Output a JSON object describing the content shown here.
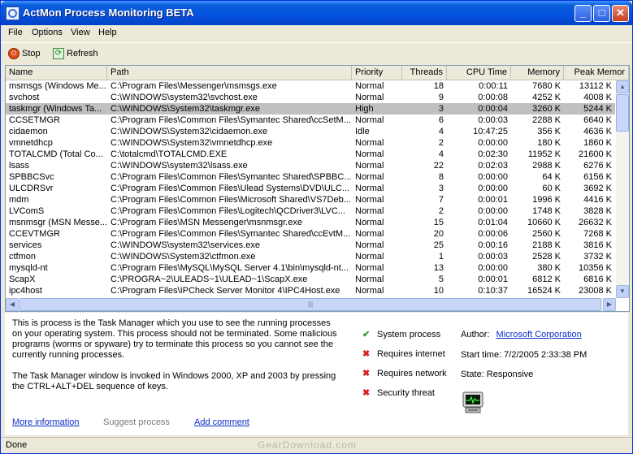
{
  "window": {
    "title": "ActMon Process Monitoring BETA",
    "buttons": {
      "minimize": "_",
      "maximize": "□",
      "close": "✕"
    }
  },
  "menu": [
    "File",
    "Options",
    "View",
    "Help"
  ],
  "toolbar": {
    "stop": "Stop",
    "refresh": "Refresh"
  },
  "columns": [
    "Name",
    "Path",
    "Priority",
    "Threads",
    "CPU Time",
    "Memory",
    "Peak Memor"
  ],
  "processes": [
    [
      "msmsgs (Windows Me...",
      "C:\\Program Files\\Messenger\\msmsgs.exe",
      "Normal",
      "18",
      "0:00:11",
      "7680 K",
      "13112 K"
    ],
    [
      "svchost",
      "C:\\WINDOWS\\system32\\svchost.exe",
      "Normal",
      "9",
      "0:00:08",
      "4252 K",
      "4008 K"
    ],
    [
      "taskmgr (Windows Ta...",
      "C:\\WINDOWS\\System32\\taskmgr.exe",
      "High",
      "3",
      "0:00:04",
      "3260 K",
      "5244 K"
    ],
    [
      "CCSETMGR",
      "C:\\Program Files\\Common Files\\Symantec Shared\\ccSetM...",
      "Normal",
      "6",
      "0:00:03",
      "2288 K",
      "6640 K"
    ],
    [
      "cidaemon",
      "C:\\WINDOWS\\System32\\cidaemon.exe",
      "Idle",
      "4",
      "10:47:25",
      "356 K",
      "4636 K"
    ],
    [
      "vmnetdhcp",
      "C:\\WINDOWS\\System32\\vmnetdhcp.exe",
      "Normal",
      "2",
      "0:00:00",
      "180 K",
      "1860 K"
    ],
    [
      "TOTALCMD (Total Co...",
      "C:\\totalcmd\\TOTALCMD.EXE",
      "Normal",
      "4",
      "0:02:30",
      "11952 K",
      "21600 K"
    ],
    [
      "lsass",
      "C:\\WINDOWS\\system32\\lsass.exe",
      "Normal",
      "22",
      "0:02:03",
      "2988 K",
      "6276 K"
    ],
    [
      "SPBBCSvc",
      "C:\\Program Files\\Common Files\\Symantec Shared\\SPBBC...",
      "Normal",
      "8",
      "0:00:00",
      "64 K",
      "6156 K"
    ],
    [
      "ULCDRSvr",
      "C:\\Program Files\\Common Files\\Ulead Systems\\DVD\\ULC...",
      "Normal",
      "3",
      "0:00:00",
      "60 K",
      "3692 K"
    ],
    [
      "mdm",
      "C:\\Program Files\\Common Files\\Microsoft Shared\\VS7Deb...",
      "Normal",
      "7",
      "0:00:01",
      "1996 K",
      "4416 K"
    ],
    [
      "LVComS",
      "C:\\Program Files\\Common Files\\Logitech\\QCDriver3\\LVC...",
      "Normal",
      "2",
      "0:00:00",
      "1748 K",
      "3828 K"
    ],
    [
      "msnmsgr (MSN Messe...",
      "C:\\Program Files\\MSN Messenger\\msnmsgr.exe",
      "Normal",
      "15",
      "0:01:04",
      "10660 K",
      "26632 K"
    ],
    [
      "CCEVTMGR",
      "C:\\Program Files\\Common Files\\Symantec Shared\\ccEvtM...",
      "Normal",
      "20",
      "0:00:06",
      "2560 K",
      "7268 K"
    ],
    [
      "services",
      "C:\\WINDOWS\\system32\\services.exe",
      "Normal",
      "25",
      "0:00:16",
      "2188 K",
      "3816 K"
    ],
    [
      "ctfmon",
      "C:\\WINDOWS\\System32\\ctfmon.exe",
      "Normal",
      "1",
      "0:00:03",
      "2528 K",
      "3732 K"
    ],
    [
      "mysqld-nt",
      "C:\\Program Files\\MySQL\\MySQL Server 4.1\\bin\\mysqld-nt...",
      "Normal",
      "13",
      "0:00:00",
      "380 K",
      "10356 K"
    ],
    [
      "ScapX",
      "C:\\PROGRA~2\\ULEADS~1\\ULEAD~1\\ScapX.exe",
      "Normal",
      "5",
      "0:00:01",
      "6812 K",
      "6816 K"
    ],
    [
      "ipc4host",
      "C:\\Program Files\\IPCheck Server Monitor 4\\IPC4Host.exe",
      "Normal",
      "10",
      "0:10:37",
      "16524 K",
      "23008 K"
    ]
  ],
  "selected_row": 2,
  "details": {
    "description": [
      "This is process is the Task Manager which you use to see the running processes on your operating system. This process should not be terminated. Some malicious programs (worms or spyware) try to terminate this process so you cannot see the currently running processes.",
      "The Task Manager window is invoked in Windows 2000, XP and 2003 by pressing the CTRL+ALT+DEL sequence of keys."
    ],
    "flags": [
      {
        "label": "System process",
        "state": "yes"
      },
      {
        "label": "Requires internet",
        "state": "no"
      },
      {
        "label": "Requires network",
        "state": "no"
      },
      {
        "label": "Security threat",
        "state": "no"
      }
    ],
    "author_label": "Author:",
    "author": "Microsoft Corporation",
    "start_time": "Start time: 7/2/2005 2:33:38 PM",
    "state": "State: Responsive",
    "links": {
      "more_info": "More information",
      "suggest": "Suggest process",
      "add_comment": "Add comment"
    }
  },
  "status": {
    "text": "Done",
    "watermark": "GearDownload.com"
  },
  "colors": {
    "selection": "#c0c0c0",
    "link": "#0a2cc8",
    "check": "#2a9a2a",
    "cross": "#d42020"
  }
}
